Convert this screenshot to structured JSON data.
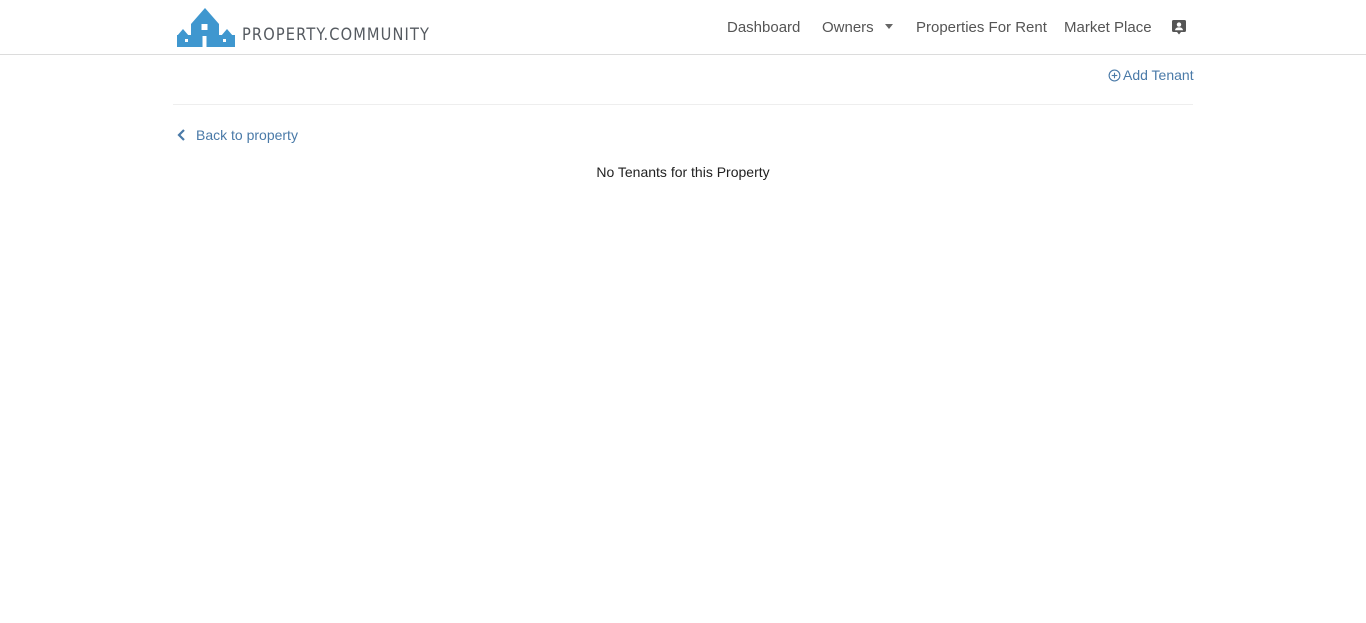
{
  "brand": {
    "name": "PROPERTY.COMMUNITY",
    "color": "#3f97cf",
    "logo_icon": "house-logo-icon"
  },
  "nav": {
    "items": [
      {
        "label": "Dashboard"
      },
      {
        "label": "Owners",
        "has_dropdown": true
      },
      {
        "label": "Properties For Rent"
      },
      {
        "label": "Market Place"
      }
    ],
    "profile_icon": "contact-card-icon"
  },
  "actions": {
    "add_tenant_label": "Add Tenant",
    "add_tenant_icon": "plus-circle-icon"
  },
  "back_link": {
    "label": "Back to property",
    "icon": "chevron-left-icon"
  },
  "main": {
    "empty_message": "No Tenants for this Property"
  },
  "colors": {
    "link": "#4a7aa8",
    "nav_text": "#555555",
    "border": "#dcdcdc"
  }
}
